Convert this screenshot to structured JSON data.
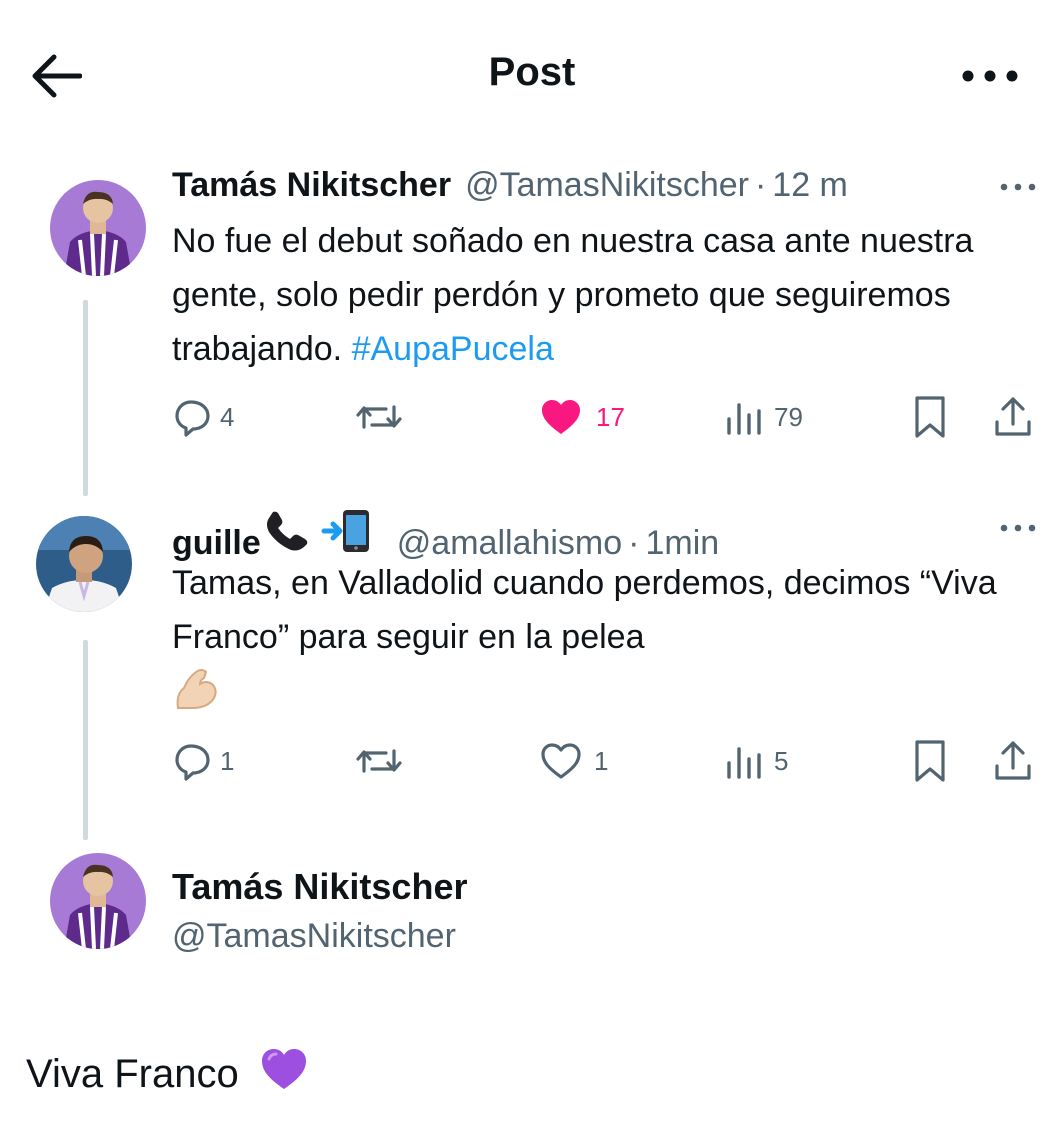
{
  "header": {
    "title": "Post"
  },
  "tweets": [
    {
      "name": "Tamás Nikitscher",
      "handle": "@TamasNikitscher",
      "separator": "·",
      "time": "12 m",
      "text": "No fue el debut soñado en nuestra casa ante nuestra gente, solo pedir perdón y prometo que seguiremos trabajando. ",
      "hashtag": "#AupaPucela",
      "replies": "4",
      "likes": "17",
      "views": "79"
    },
    {
      "name": "guille",
      "name_emojis": [
        "telephone-receiver",
        "mobile-phone-arrow"
      ],
      "handle": "@amallahismo",
      "separator": "·",
      "time": "1min",
      "text": "Tamas, en Valladolid cuando perdemos, decimos “Viva Franco” para seguir en la pelea",
      "text_emoji": "flexed-biceps",
      "replies": "1",
      "likes": "1",
      "views": "5"
    }
  ],
  "main": {
    "name": "Tamás Nikitscher",
    "handle": "@TamasNikitscher",
    "text": "Viva Franco",
    "text_emoji": "purple-heart"
  },
  "colors": {
    "accent": "#1d9bf0",
    "like": "#f91880",
    "secondary_text": "#536471",
    "thread_line": "#cfd9de",
    "kit_purple": "#7a3fb0"
  }
}
